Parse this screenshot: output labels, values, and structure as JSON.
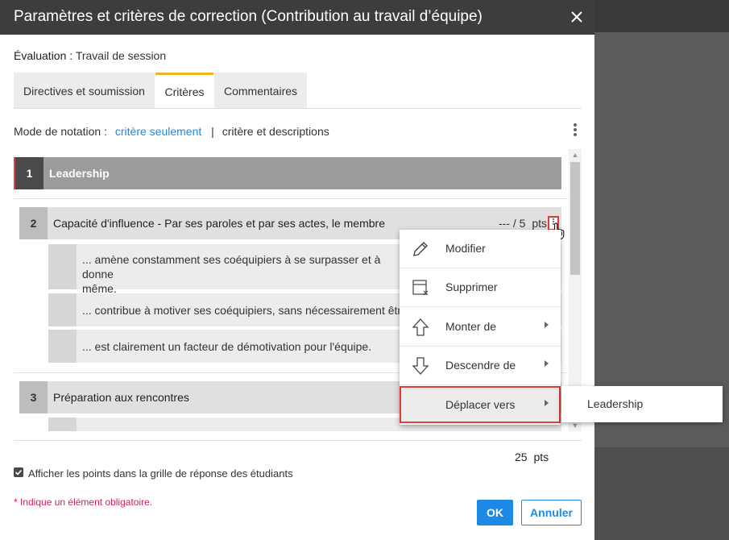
{
  "dialog": {
    "title": "Paramètres et critères de correction (Contribution au travail d’équipe)",
    "evaluation_label": "Évaluation :",
    "evaluation_value": "Travail de session"
  },
  "tabs": [
    {
      "label": "Directives et soumission",
      "active": false
    },
    {
      "label": "Critères",
      "active": true
    },
    {
      "label": "Commentaires",
      "active": false
    }
  ],
  "notation": {
    "label": "Mode de notation :",
    "selected": "critère seulement",
    "separator": "|",
    "other": "critère et descriptions"
  },
  "criteria": [
    {
      "num": "1",
      "name": "Leadership"
    },
    {
      "num": "2",
      "name": "Capacité d'influence - Par ses paroles et par ses actes, le membre",
      "score": "---",
      "slash": "/",
      "max": "5",
      "unit": "pts"
    },
    {
      "num": "3",
      "name": "Préparation aux rencontres"
    }
  ],
  "descriptors": [
    {
      "text": "... amène constamment ses coéquipiers à se surpasser et à donne",
      "text2": "même."
    },
    {
      "text": "... contribue à motiver ses coéquipiers, sans nécessairement être l"
    },
    {
      "text": "... est clairement un facteur de démotivation pour l'équipe."
    }
  ],
  "total": {
    "value": "25",
    "unit": "pts"
  },
  "show_points": {
    "checked": true,
    "label": "Afficher les points dans la grille de réponse des étudiants"
  },
  "required_note": "* Indique un élément obligatoire.",
  "buttons": {
    "ok": "OK",
    "cancel": "Annuler"
  },
  "context_menu": [
    {
      "label": "Modifier",
      "icon": "pencil-icon",
      "submenu": false
    },
    {
      "label": "Supprimer",
      "icon": "delete-icon",
      "submenu": false
    },
    {
      "label": "Monter de",
      "icon": "arrow-up-icon",
      "submenu": true
    },
    {
      "label": "Descendre de",
      "icon": "arrow-down-icon",
      "submenu": true
    },
    {
      "label": "Déplacer vers",
      "icon": "",
      "submenu": true,
      "highlighted": true
    }
  ],
  "submenu": {
    "items": [
      "Leadership"
    ]
  },
  "colors": {
    "accent": "#1e88e5",
    "tab_active": "#f0b323",
    "highlight": "#e53935",
    "required": "#d81b60"
  }
}
